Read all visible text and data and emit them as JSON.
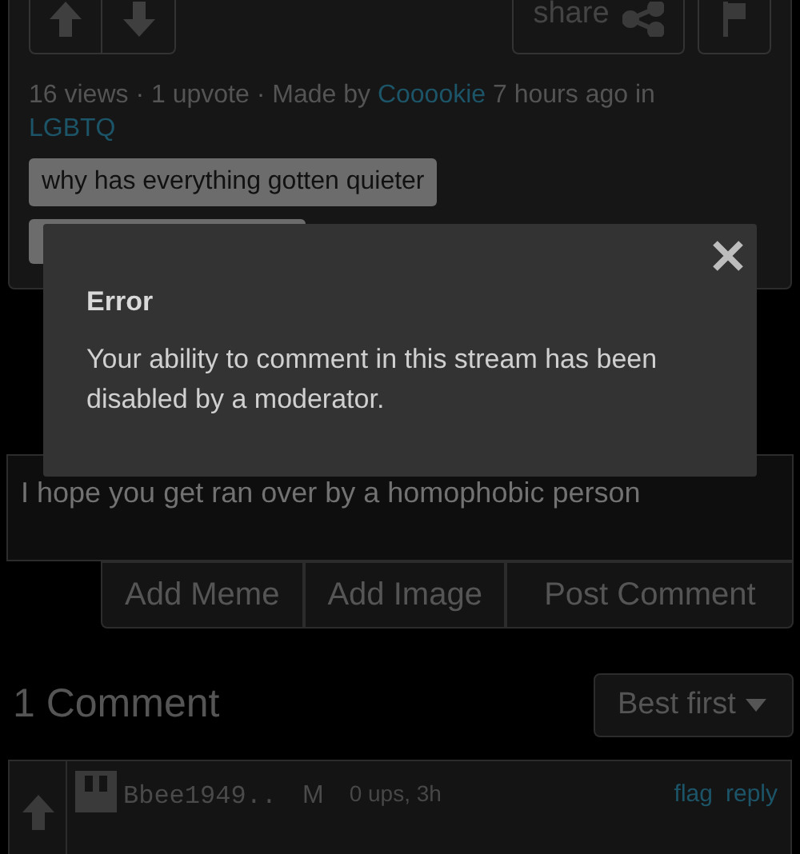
{
  "post": {
    "share": "share",
    "meta": [
      {
        "kind": "text",
        "text": "16 views"
      },
      {
        "kind": "dot",
        "text": "·"
      },
      {
        "kind": "text",
        "text": "1 upvote"
      },
      {
        "kind": "dot",
        "text": "·"
      },
      {
        "kind": "text",
        "text": "Made by"
      },
      {
        "kind": "link",
        "text": "Cooookie"
      },
      {
        "kind": "text",
        "text": "7 hours ago in"
      },
      {
        "kind": "link",
        "text": "LGBTQ"
      }
    ],
    "tags": [
      {
        "kind": "text",
        "label": "why has everything gotten quieter"
      },
      {
        "kind": "covered"
      }
    ]
  },
  "modal": {
    "title": "Error",
    "message": "Your ability to comment in this stream has been disabled by a moderator."
  },
  "comment_box": {
    "value": "I hope you get ran over by a homophobic person"
  },
  "comment_buttons": [
    "Add Meme",
    "Add Image",
    "Post Comment"
  ],
  "comments_heading": "1 Comment",
  "sort": {
    "label": "Best first"
  },
  "comments": [
    {
      "user": "Bbee1949..",
      "badge": "M",
      "info": "0 ups, 3h",
      "actions": [
        "flag",
        "reply"
      ]
    }
  ]
}
